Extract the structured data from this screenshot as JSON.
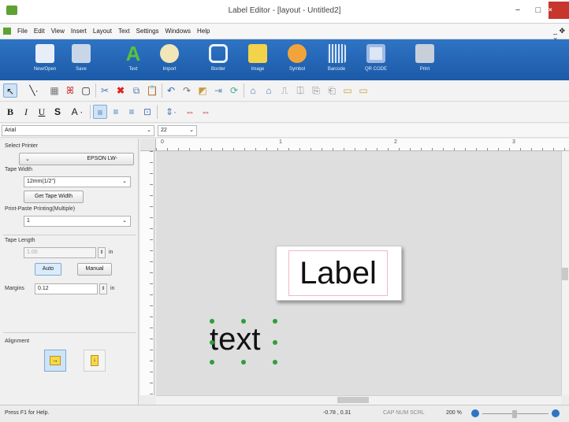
{
  "window": {
    "title": "Label Editor - [layout - Untitled2]",
    "minimize": "−",
    "maximize": "□",
    "close": "×",
    "menu_restore": "_ ✥ ×"
  },
  "menu": [
    "File",
    "Edit",
    "View",
    "Insert",
    "Layout",
    "Text",
    "Settings",
    "Windows",
    "Help"
  ],
  "ribbon": [
    {
      "label": "New/Open",
      "icon": "document-icon",
      "color": "#e8eef7"
    },
    {
      "label": "Save",
      "icon": "save-icon",
      "color": "#c9d6e8"
    },
    {
      "label": "Text",
      "icon": "text-icon",
      "color": "#59c13b"
    },
    {
      "label": "Import",
      "icon": "import-icon",
      "color": "#f0e6b8"
    },
    {
      "label": "Border",
      "icon": "border-icon",
      "color": "#e9f0fa"
    },
    {
      "label": "Image",
      "icon": "image-icon",
      "color": "#f3d34a"
    },
    {
      "label": "Symbol",
      "icon": "symbol-icon",
      "color": "#f2a43c"
    },
    {
      "label": "Barcode",
      "icon": "barcode-icon",
      "color": "#dbe6f6"
    },
    {
      "label": "QR CODE",
      "icon": "qr-code-icon",
      "color": "#dbe6f6"
    },
    {
      "label": "Print",
      "icon": "printer-icon",
      "color": "#c7cfdb"
    }
  ],
  "font": {
    "name": "Arial",
    "size": "22"
  },
  "format": {
    "bold": "B",
    "italic": "I",
    "underline": "U",
    "font_a": "A"
  },
  "left_panel": {
    "select_printer": "Select Printer",
    "printer": "EPSON LW-",
    "tape_width_label": "Tape Width",
    "tape_width_value": "12mm(1/2\")",
    "get_tape_width": "Get Tape Width",
    "print_paste_label": "Print-Paste Printing(Multiple)",
    "print_paste_value": "1",
    "tape_length_label": "Tape Length",
    "tape_length_value": "1.00",
    "unit": "in",
    "auto": "Auto",
    "manual": "Manual",
    "margins_label": "Margins",
    "margins_value": "0.12",
    "alignment_label": "Alignment"
  },
  "ruler": {
    "h": [
      "0",
      "1",
      "2",
      "3"
    ]
  },
  "canvas": {
    "label_text": "Label",
    "text_object": "text"
  },
  "status": {
    "help": "Press F1 for Help.",
    "coords": "-0.78 , 0.31",
    "keys": "CAP NUM SCRL",
    "zoom": "200 %"
  }
}
